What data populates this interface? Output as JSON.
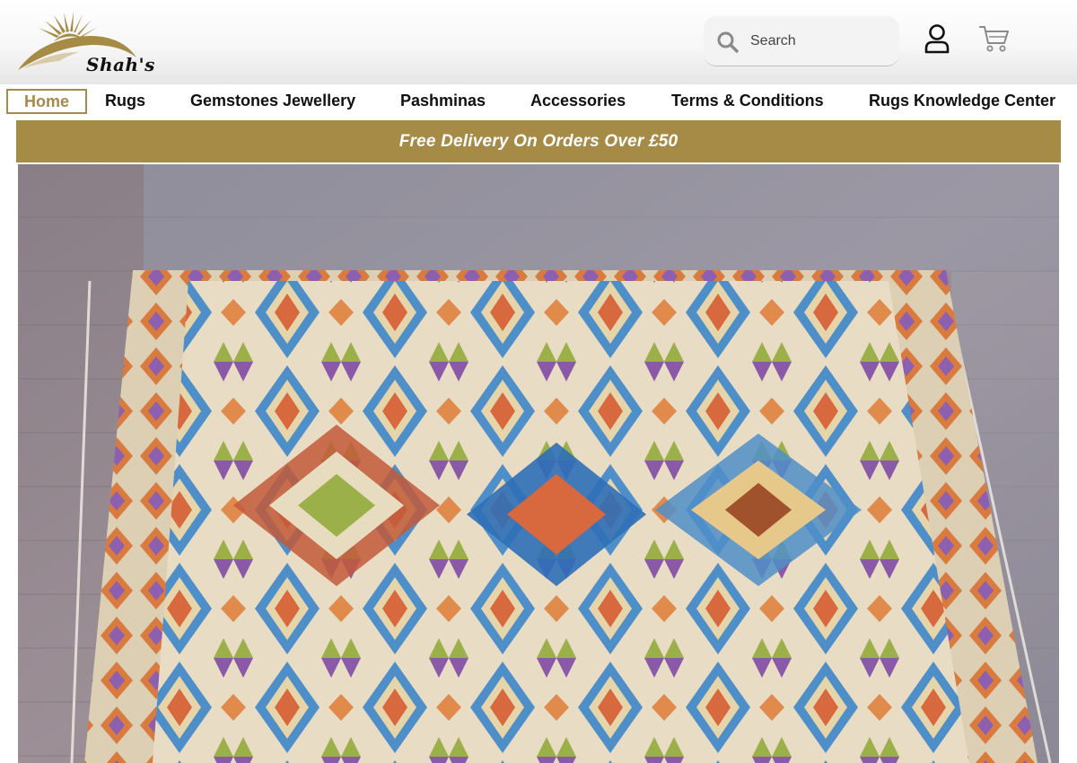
{
  "header": {
    "logo": {
      "text": "Shah's",
      "icon": "sunrise-logo-icon",
      "color": "#a68b47"
    },
    "search": {
      "placeholder": "Search",
      "icon": "search-icon"
    },
    "account_icon": "user-icon",
    "cart_icon": "cart-icon"
  },
  "nav": {
    "items": [
      {
        "label": "Home",
        "active": true
      },
      {
        "label": "Rugs"
      },
      {
        "label": "Gemstones Jewellery"
      },
      {
        "label": "Pashminas"
      },
      {
        "label": "Accessories"
      },
      {
        "label": "Terms & Conditions"
      },
      {
        "label": "Rugs Knowledge Center"
      }
    ]
  },
  "promo": {
    "text": "Free Delivery On Orders Over £50",
    "color": "#a68b47"
  },
  "hero": {
    "image": "kilim-rug-photo"
  },
  "colors": {
    "accent": "#a68b47"
  }
}
